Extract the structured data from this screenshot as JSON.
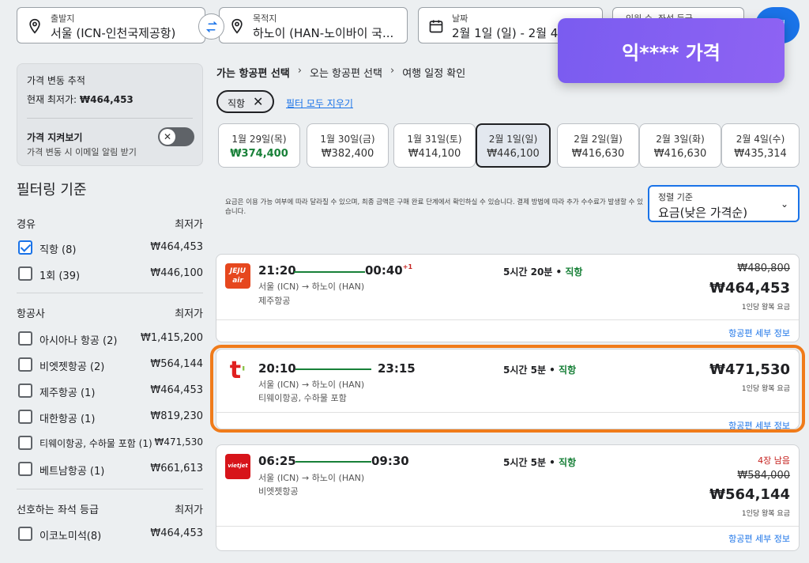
{
  "search": {
    "origin_label": "출발지",
    "origin_value": "서울 (ICN-인천국제공항)",
    "dest_label": "목적지",
    "dest_value": "하노이 (HAN-노이바이 국...",
    "date_label": "날짜",
    "date_value": "2월 1일 (일) - 2월 4일",
    "pax_label": "인원 수, 좌석 등급",
    "search_label": "검색"
  },
  "tracker": {
    "title": "가격 변동 추적",
    "current_prefix": "현재 최저가: ",
    "current_price": "₩464,453",
    "watch_title": "가격 지켜보기",
    "watch_sub": "가격 변동 시 이메일 알림 받기",
    "toggle_symbol": "✕"
  },
  "filters": {
    "title": "필터링 기준",
    "stops": {
      "header": "경유",
      "header_right": "최저가",
      "items": [
        {
          "label": "직항 (8)",
          "price": "₩464,453",
          "checked": true
        },
        {
          "label": "1회 (39)",
          "price": "₩446,100",
          "checked": false
        }
      ]
    },
    "airlines": {
      "header": "항공사",
      "header_right": "최저가",
      "items": [
        {
          "label": "아시아나 항공 (2)",
          "price": "₩1,415,200"
        },
        {
          "label": "비엣젯항공 (2)",
          "price": "₩564,144"
        },
        {
          "label": "제주항공 (1)",
          "price": "₩464,453"
        },
        {
          "label": "대한항공 (1)",
          "price": "₩819,230"
        },
        {
          "label": "티웨이항공, 수하물 포함 (1)",
          "price": "₩471,530"
        },
        {
          "label": "베트남항공 (1)",
          "price": "₩661,613"
        }
      ]
    },
    "cabin": {
      "header": "선호하는 좌석 등급",
      "header_right": "최저가",
      "items": [
        {
          "label": "이코노미석(8)",
          "price": "₩464,453"
        }
      ]
    }
  },
  "breadcrumb": {
    "step1": "가는 항공편 선택",
    "step2": "오는 항공편 선택",
    "step3": "여행 일정 확인",
    "sep": "›"
  },
  "chip": {
    "label": "직항",
    "close": "✕"
  },
  "clear_all": "필터 모두 지우기",
  "dates": [
    {
      "date": "1월 29일(목)",
      "price": "₩374,400",
      "lowest": true
    },
    {
      "date": "1월 30일(금)",
      "price": "₩382,400"
    },
    {
      "date": "1월 31일(토)",
      "price": "₩414,100"
    },
    {
      "date": "2월 1일(일)",
      "price": "₩446,100",
      "selected": true
    },
    {
      "date": "2월 2일(월)",
      "price": "₩416,630"
    },
    {
      "date": "2월 3일(화)",
      "price": "₩416,630"
    },
    {
      "date": "2월 4일(수)",
      "price": "₩435,314"
    }
  ],
  "notice": "요금은 이용 가능 여부에 따라 달라질 수 있으며, 최종 금액은 구매 완료 단계에서 확인하실 수 있습니다. 결제 방법에 따라 추가 수수료가 발생할 수 있습니다.",
  "sort": {
    "label": "정렬 기준",
    "value": "요금(낮은 가격순)",
    "chevron": "⌄"
  },
  "flights": [
    {
      "logo": "JEJU air",
      "logo_color": "#e6471e",
      "depart": "21:20",
      "arrive": "00:40",
      "plus_day": "+1",
      "route": "서울 (ICN) → 하노이 (HAN)",
      "airline": "제주항공",
      "duration": "5시간 20분",
      "dot": " • ",
      "stops": "직항",
      "old_price": "₩480,800",
      "price": "₩464,453",
      "unit": "1인당 왕복 요금",
      "detail": "항공편 세부 정보"
    },
    {
      "logo": "t'",
      "logo_color": "#e02020",
      "depart": "20:10",
      "arrive": "23:15",
      "route": "서울 (ICN) → 하노이 (HAN)",
      "airline": "티웨이항공, 수하물 포함",
      "duration": "5시간 5분",
      "dot": " • ",
      "stops": "직항",
      "price": "₩471,530",
      "unit": "1인당 왕복 요금",
      "detail": "항공편 세부 정보"
    },
    {
      "logo": "vietjet",
      "logo_color": "#d7141a",
      "depart": "06:25",
      "arrive": "09:30",
      "route": "서울 (ICN) → 하노이 (HAN)",
      "airline": "비엣젯항공",
      "duration": "5시간 5분",
      "dot": " • ",
      "stops": "직항",
      "seats_left": "4장 남음",
      "old_price": "₩584,000",
      "price": "₩564,144",
      "unit": "1인당 왕복 요금",
      "detail": "항공편 세부 정보"
    }
  ],
  "overlay": {
    "text": "익**** 가격"
  },
  "colors": {
    "accent": "#1a73e8",
    "nonstop": "#188038",
    "highlight": "#f07b1a",
    "overlay": "#7a5cf0"
  }
}
